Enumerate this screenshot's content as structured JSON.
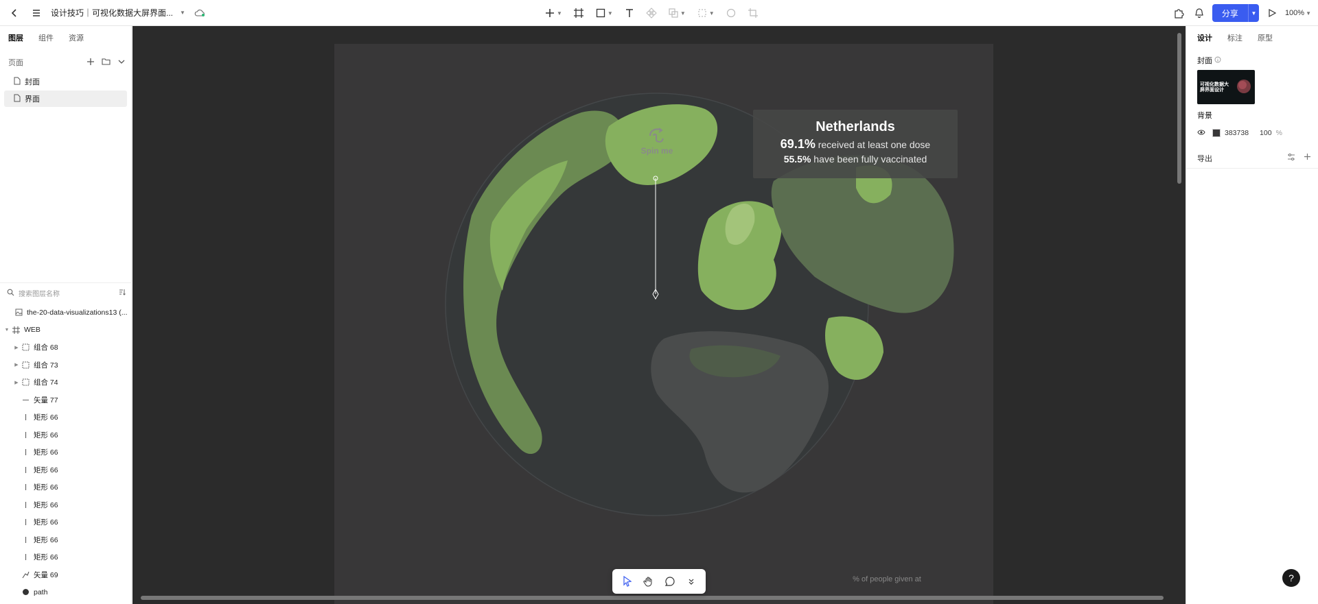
{
  "topbar": {
    "doc_title": "设计技巧｜可视化数据大屏界面...",
    "zoom": "100%",
    "share_label": "分享"
  },
  "left_panel": {
    "tabs": [
      "图层",
      "组件",
      "资源"
    ],
    "pages_label": "页面",
    "pages": [
      "封面",
      "界面"
    ],
    "search_placeholder": "搜索图层名称",
    "layers": [
      {
        "name": "the-20-data-visualizations13 (...",
        "type": "image"
      },
      {
        "name": "WEB",
        "type": "frame"
      },
      {
        "name": "组合 68",
        "type": "group"
      },
      {
        "name": "组合 73",
        "type": "group"
      },
      {
        "name": "组合 74",
        "type": "group"
      },
      {
        "name": "矢量 77",
        "type": "line"
      },
      {
        "name": "矩形 66",
        "type": "rect"
      },
      {
        "name": "矩形 66",
        "type": "rect"
      },
      {
        "name": "矩形 66",
        "type": "rect"
      },
      {
        "name": "矩形 66",
        "type": "rect"
      },
      {
        "name": "矩形 66",
        "type": "rect"
      },
      {
        "name": "矩形 66",
        "type": "rect"
      },
      {
        "name": "矩形 66",
        "type": "rect"
      },
      {
        "name": "矩形 66",
        "type": "rect"
      },
      {
        "name": "矩形 66",
        "type": "rect"
      },
      {
        "name": "矢量 69",
        "type": "vector"
      },
      {
        "name": "path",
        "type": "path"
      }
    ]
  },
  "canvas": {
    "spin_label": "Spin me",
    "tooltip": {
      "country": "Netherlands",
      "dose_pct": "69.1%",
      "dose_text": "received at least one dose",
      "full_pct": "55.5%",
      "full_text": "have been fully vaccinated"
    },
    "axis_note": "% of people given at",
    "colors": {
      "artboard_bg": "#383738",
      "land_high": "#86b05e",
      "land_mid": "#6b8a52",
      "land_low": "#4f5c49",
      "land_none": "#4a4c4c"
    }
  },
  "right_panel": {
    "tabs": [
      "设计",
      "标注",
      "原型"
    ],
    "cover_label": "封面",
    "cover_thumb_text": "可视化数据大屏界面设计",
    "background_label": "背景",
    "bg_hex": "383738",
    "bg_opacity": "100",
    "bg_pct": "%",
    "export_label": "导出"
  },
  "help": "?"
}
